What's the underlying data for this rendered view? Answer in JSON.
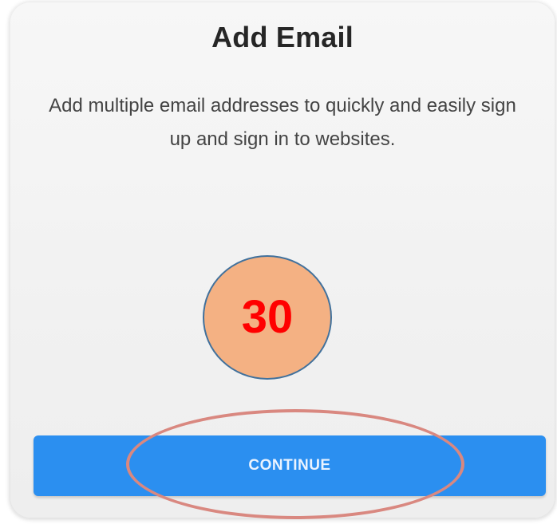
{
  "dialog": {
    "title": "Add Email",
    "description": "Add multiple email addresses to quickly and easily sign up and sign in to websites.",
    "continue_label": "CONTINUE"
  },
  "annotation": {
    "step_number": "30",
    "badge_fill": "#f4b183",
    "badge_border": "#41719c",
    "number_color": "#ff0000",
    "highlight_color": "#d98880"
  },
  "colors": {
    "button_blue": "#2b8ff0",
    "card_background": "#f5f5f5"
  }
}
